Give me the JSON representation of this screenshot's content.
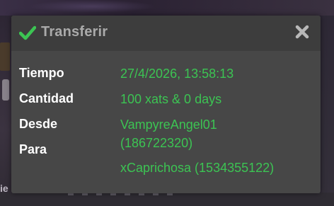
{
  "dialog": {
    "title": "Transferir",
    "accent_color": "#3cc453",
    "header_icon": "check-icon",
    "close_icon": "close-icon",
    "rows": {
      "time": {
        "label": "Tiempo",
        "value": "27/4/2026, 13:58:13"
      },
      "amount": {
        "label": "Cantidad",
        "value": "100 xats & 0 days"
      },
      "from": {
        "label": "Desde",
        "value_line1": "VampyreAngel01",
        "value_line2": "(186722320)"
      },
      "to": {
        "label": "Para",
        "value": "xCaprichosa (1534355122)"
      }
    }
  },
  "background": {
    "bottom_fragment": "ie"
  }
}
